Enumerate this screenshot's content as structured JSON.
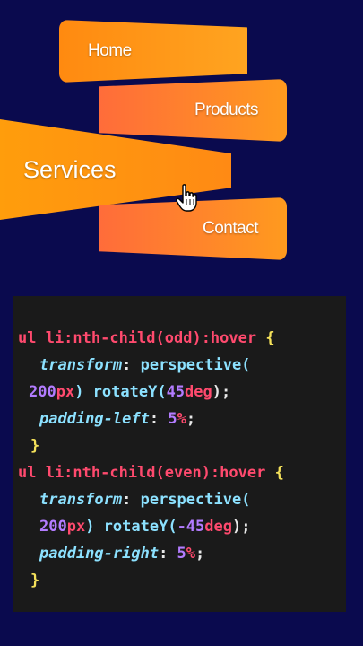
{
  "menu": {
    "items": [
      {
        "id": "home",
        "label": "Home"
      },
      {
        "id": "products",
        "label": "Products"
      },
      {
        "id": "services",
        "label": "Services"
      },
      {
        "id": "contact",
        "label": "Contact"
      }
    ]
  },
  "code": {
    "rule1": {
      "selector": "ul li:nth-child(odd):hover",
      "open": "{",
      "prop1": "transform",
      "val1a": "perspective(",
      "val1b_num": "200",
      "val1b_unit": "px",
      "val1b_rest": ") rotateY(",
      "val1b_num2": "45",
      "val1b_unit2": "deg",
      "val1b_end": ");",
      "prop2": "padding-left",
      "val2_num": "5",
      "val2_unit": "%",
      "close": "}"
    },
    "rule2": {
      "selector": "ul li:nth-child(even):hover",
      "open": "{",
      "prop1": "transform",
      "val1a": "perspective(",
      "val1b_num": "200",
      "val1b_unit": "px",
      "val1b_rest": ") rotateY(",
      "val1b_num2": "-45",
      "val1b_unit2": "deg",
      "val1b_end": ");",
      "prop2": "padding-right",
      "val2_num": "5",
      "val2_unit": "%",
      "close": "}"
    }
  },
  "colors": {
    "background": "#0a0a4e",
    "menu_orange": "#ff9d0c",
    "menu_coral": "#ff6c3a",
    "code_bg": "#1a1a1a"
  },
  "icons": {
    "cursor": "hand-pointer-icon"
  }
}
